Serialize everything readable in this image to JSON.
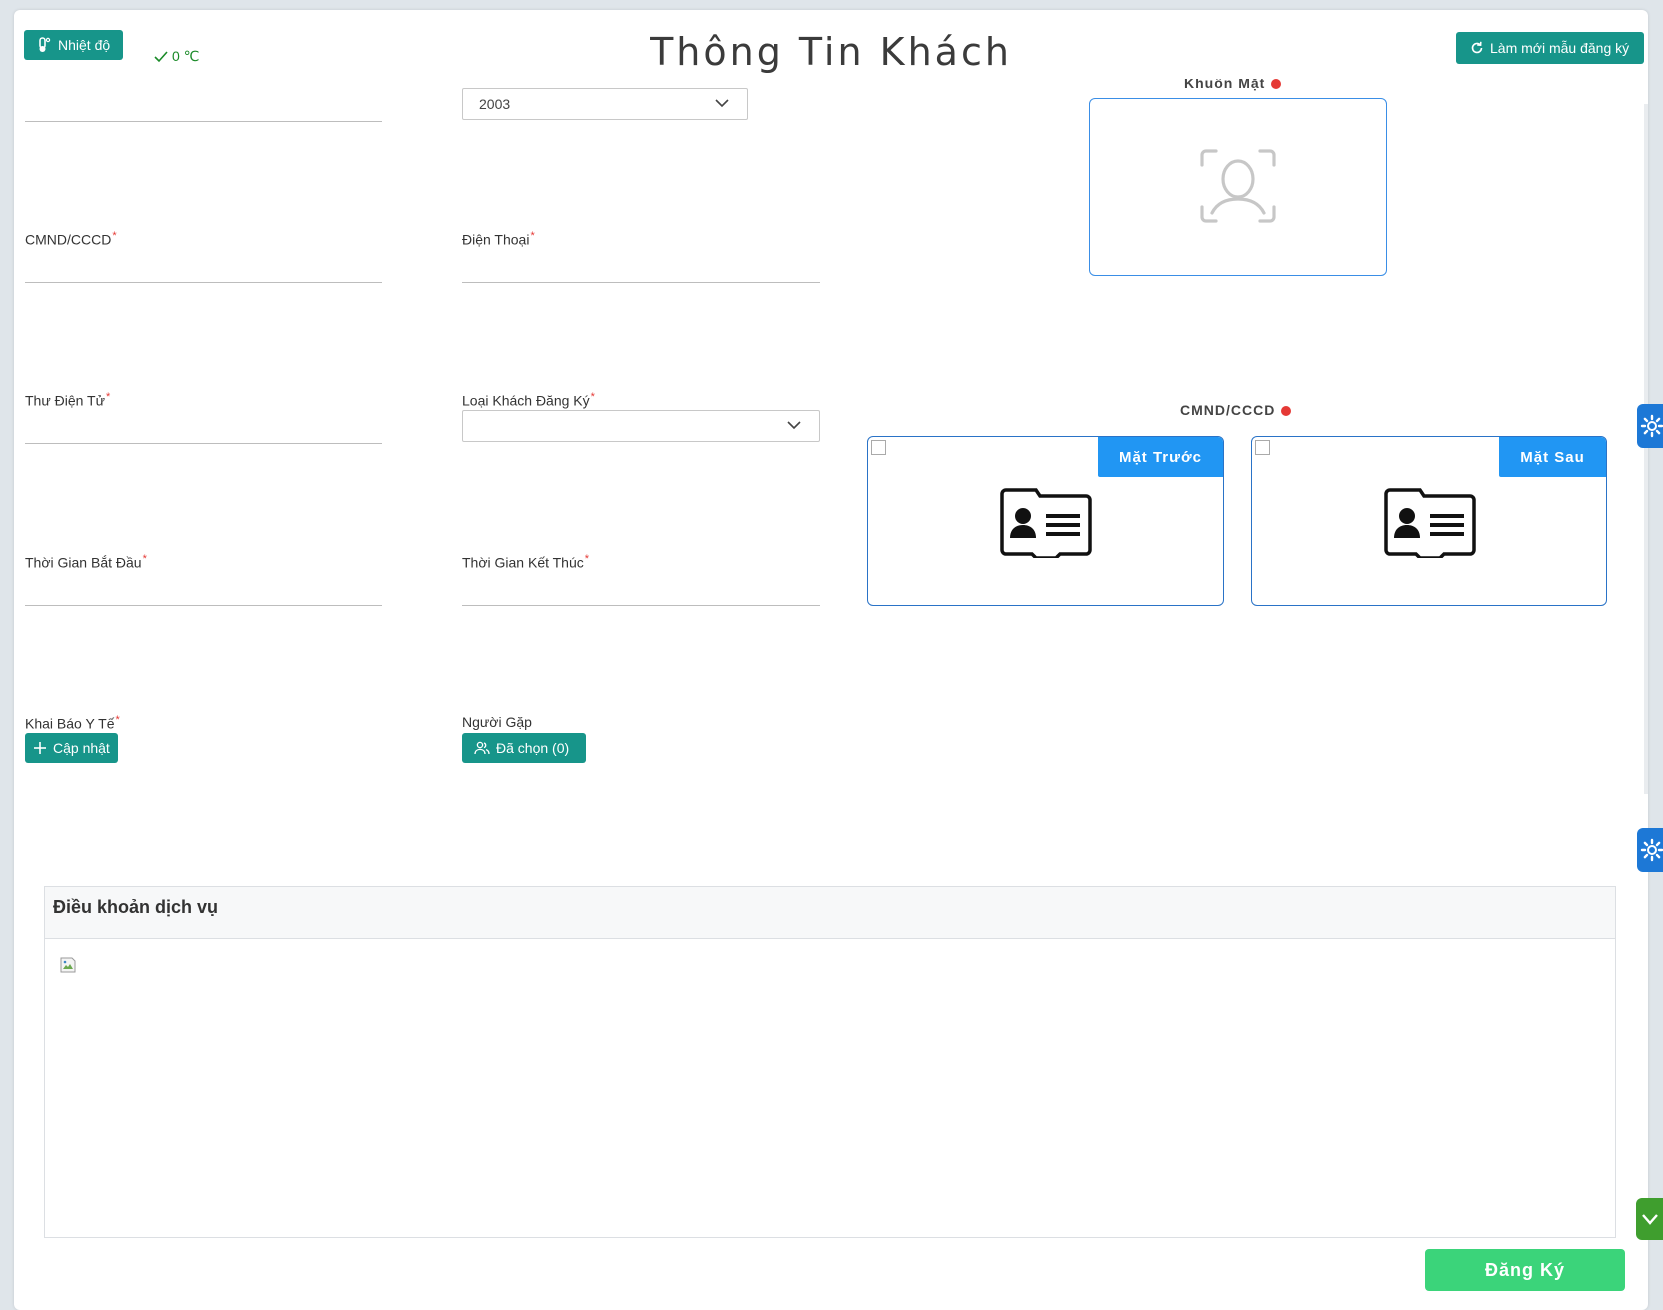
{
  "header": {
    "temperature_button": "Nhiệt độ",
    "temperature_value": "0 ℃",
    "title": "Thông Tin Khách",
    "refresh_button": "Làm mới mẫu đăng ký"
  },
  "form": {
    "birth_year_value": "2003",
    "id_label": "CMND/CCCD",
    "phone_label": "Điện Thoại",
    "email_label": "Thư Điện Tử",
    "guest_type_label": "Loại Khách Đăng Ký",
    "start_time_label": "Thời Gian Bắt Đầu",
    "end_time_label": "Thời Gian Kết Thúc",
    "health_label": "Khai Báo Y Tế",
    "health_button": "Cập nhật",
    "meet_label": "Người Gặp",
    "meet_button": "Đã chọn (0)",
    "required_mark": "*"
  },
  "photos": {
    "face_label": "Khuôn Mặt",
    "id_label": "CMND/CCCD",
    "front_tab": "Mặt Trước",
    "back_tab": "Mặt Sau"
  },
  "terms": {
    "title": "Điều khoản dịch vụ"
  },
  "actions": {
    "submit": "Đăng Ký"
  },
  "colors": {
    "teal": "#17958a",
    "blue": "#2196f3",
    "green": "#3bd47a",
    "required": "#e53935"
  },
  "icons": [
    "thermometer-icon",
    "check-icon",
    "refresh-icon",
    "chevron-down-icon",
    "face-scan-icon",
    "id-card-icon",
    "plus-icon",
    "users-icon",
    "gear-icon"
  ]
}
